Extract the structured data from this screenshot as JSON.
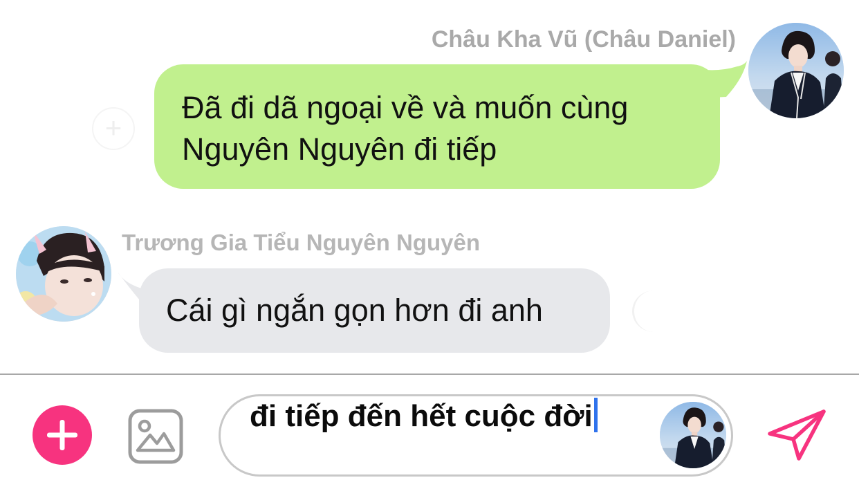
{
  "messages": [
    {
      "direction": "outgoing",
      "sender": "Châu Kha Vũ (Châu Daniel)",
      "text": "Đã đi dã ngoại về và muốn cùng Nguyên Nguyên đi tiếp",
      "bubble_color": "#c1f08e"
    },
    {
      "direction": "incoming",
      "sender": "Trương Gia Tiểu Nguyên Nguyên",
      "text": "Cái gì ngắn gọn hơn đi anh",
      "bubble_color": "#e7e8eb"
    }
  ],
  "composer": {
    "draft_text": "đi tiếp đến hết cuộc đời",
    "plus_icon": "plus-icon",
    "image_icon": "image-icon",
    "send_icon": "send-icon",
    "accent_color": "#f7337f",
    "caret_color": "#2f72ec"
  }
}
